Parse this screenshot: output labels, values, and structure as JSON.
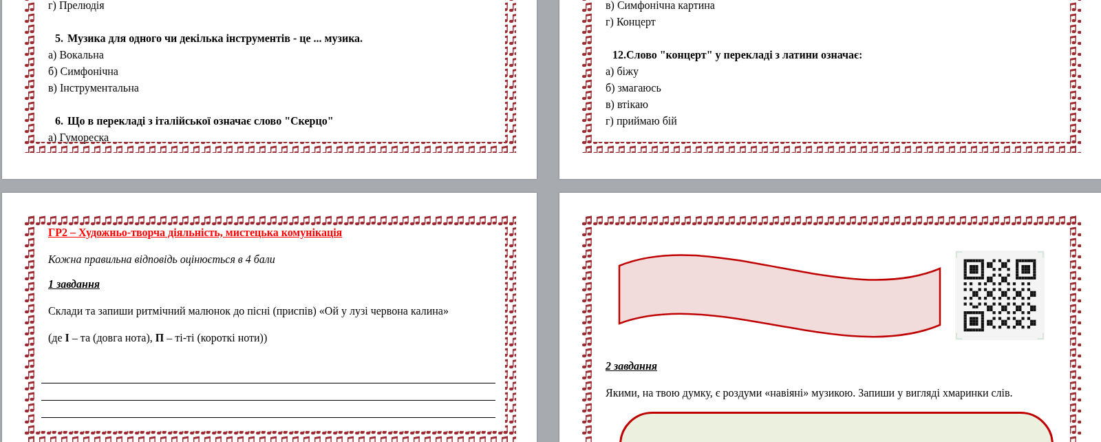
{
  "pages": [
    {
      "kind": "continued",
      "blocks": [
        {
          "kind": "option",
          "text": "г) Прелюдія"
        },
        {
          "kind": "gap"
        },
        {
          "kind": "question",
          "number": "5.",
          "text": "Музика для одного чи декілька інструментів - це ... музика."
        },
        {
          "kind": "option",
          "text": "а) Вокальна"
        },
        {
          "kind": "option",
          "text": "б) Симфонічна"
        },
        {
          "kind": "option",
          "text": "в) Інструментальна"
        },
        {
          "kind": "gap"
        },
        {
          "kind": "question",
          "number": "6.",
          "text": "Що в перекладі з італійської означає слово \"Скерцо\""
        },
        {
          "kind": "option",
          "text": "а) Гумореска"
        }
      ]
    },
    {
      "kind": "continued",
      "blocks": [
        {
          "kind": "option",
          "text": "в) Симфонічна картина"
        },
        {
          "kind": "option",
          "text": "г) Концерт"
        },
        {
          "kind": "gap"
        },
        {
          "kind": "question",
          "number": "12.",
          "text": "Слово \"концерт\" у перекладі з латини означає:"
        },
        {
          "kind": "option",
          "text": "а) біжу"
        },
        {
          "kind": "option",
          "text": "б) змагаюсь"
        },
        {
          "kind": "option",
          "text": "в) втікаю"
        },
        {
          "kind": "option",
          "text": "г) приймаю бій"
        }
      ]
    },
    {
      "kind": "new",
      "blocks": [
        {
          "kind": "heading",
          "text": "ГР2 – Художньо-творча діяльність, мистецька комунікація"
        },
        {
          "kind": "note",
          "text": "Кожна правильна відповідь оцінюється в 4 бали"
        },
        {
          "kind": "task",
          "text": "1 завдання"
        },
        {
          "kind": "paragraph",
          "text": "Склади та запиши ритмічний малюнок до пісні (приспів)  «Ой у лузі червона калина»"
        },
        {
          "kind": "paragraph",
          "text": "(де **I** – та (довга нота), **П** – ті-ті (короткі ноти))"
        },
        {
          "kind": "answer_lines"
        }
      ]
    },
    {
      "kind": "new",
      "blocks": [
        {
          "kind": "banner_row"
        },
        {
          "kind": "task",
          "text": "2 завдання"
        },
        {
          "kind": "paragraph",
          "text": "Якими, на твою думку, є роздуми «навіяні» музикою. Запиши у вигляді хмаринки слів."
        },
        {
          "kind": "cloud_box"
        }
      ]
    }
  ]
}
